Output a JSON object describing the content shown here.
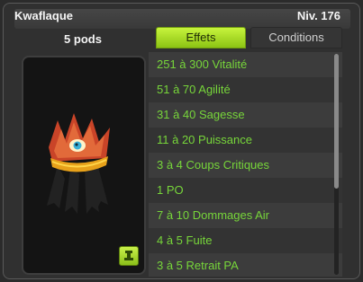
{
  "header": {
    "item_name": "Kwaflaque",
    "level": "Niv. 176"
  },
  "weight": "5 pods",
  "tabs": [
    {
      "label": "Effets",
      "active": true
    },
    {
      "label": "Conditions",
      "active": false
    }
  ],
  "effects": [
    "251 à 300 Vitalité",
    "51 à 70 Agilité",
    "31 à 40 Sagesse",
    "11 à 20 Puissance",
    "3 à 4 Coups Critiques",
    "1 PO",
    "7 à 10 Dommages Air",
    "4 à 5 Fuite",
    "3 à 5 Retrait PA"
  ],
  "colors": {
    "accent": "#9bd420",
    "effect_text": "#77d63a",
    "panel": "#303030"
  },
  "icons": {
    "item_image": "red-crown-icon",
    "link_button": "set-link-icon"
  }
}
